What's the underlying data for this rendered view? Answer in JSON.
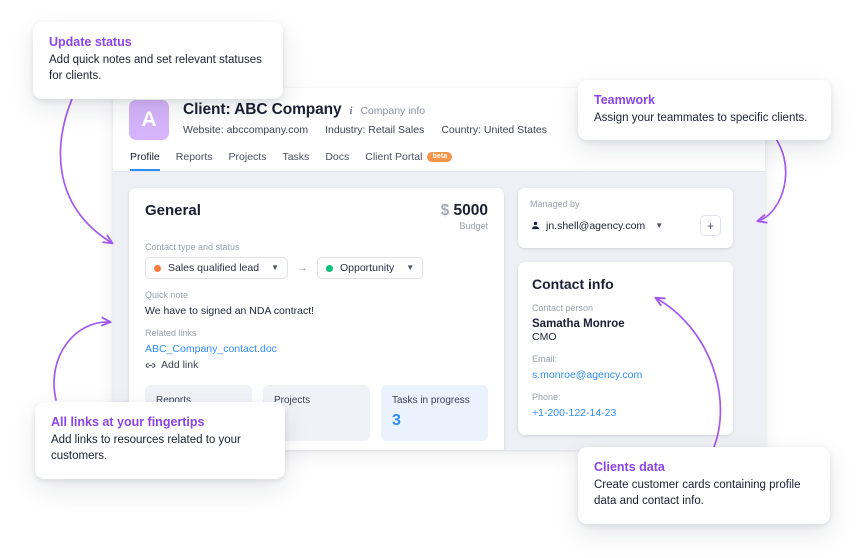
{
  "app": {
    "header": {
      "avatar_letter": "A",
      "client_title": "Client: ABC Company",
      "info_icon": "info-icon",
      "company_info_label": "Company info",
      "meta": [
        "Website: abccompany.com",
        "Industry: Retail Sales",
        "Country: United States"
      ]
    },
    "tabs": [
      {
        "label": "Profile",
        "active": true
      },
      {
        "label": "Reports",
        "active": false
      },
      {
        "label": "Projects",
        "active": false
      },
      {
        "label": "Tasks",
        "active": false
      },
      {
        "label": "Docs",
        "active": false
      },
      {
        "label": "Client Portal",
        "active": false,
        "badge": "beta"
      }
    ],
    "general": {
      "title": "General",
      "budget_currency": "$",
      "budget_amount": "5000",
      "budget_label": "Budget",
      "contact_status_label": "Contact type and status",
      "status_from": {
        "label": "Sales qualified lead",
        "color": "#f97b3d"
      },
      "status_arrow": "→",
      "status_to": {
        "label": "Opportunity",
        "color": "#07c07e"
      },
      "quick_note_label": "Quick note",
      "quick_note_text": "We have to signed an NDA contract!",
      "related_links_label": "Related links",
      "related_link": "ABC_Company_contact.doc",
      "add_link_icon": "link-icon",
      "add_link_label": "Add link"
    },
    "stats": [
      {
        "label": "Reports",
        "value": "",
        "highlight": false
      },
      {
        "label": "Projects",
        "value": "",
        "highlight": false
      },
      {
        "label": "Tasks in progress",
        "value": "3",
        "highlight": true
      }
    ],
    "managed": {
      "label": "Managed by",
      "user_icon": "person-icon",
      "user": "jn.shell@agency.com",
      "chevron": "chevron-down-icon",
      "add_button": "+"
    },
    "contact_info": {
      "title": "Contact info",
      "person_label": "Contact person",
      "person_name": "Samatha Monroe",
      "person_role": "CMO",
      "email_label": "Email:",
      "email": "s.monroe@agency.com",
      "phone_label": "Phone:",
      "phone": "+1-200-122-14-23"
    }
  },
  "callouts": [
    {
      "title": "Update status",
      "body": "Add quick notes and set relevant statuses for clients."
    },
    {
      "title": "Teamwork",
      "body": "Assign your teammates to specific clients."
    },
    {
      "title": "All links at your fingertips",
      "body": "Add links to resources related to your customers."
    },
    {
      "title": "Clients data",
      "body": "Create customer cards containing profile data and contact info."
    }
  ],
  "colors": {
    "accent_purple": "#8b44e8",
    "link_blue": "#2f8df6",
    "avatar_purple": "#d6b4fb",
    "badge_orange": "#f8934a"
  }
}
